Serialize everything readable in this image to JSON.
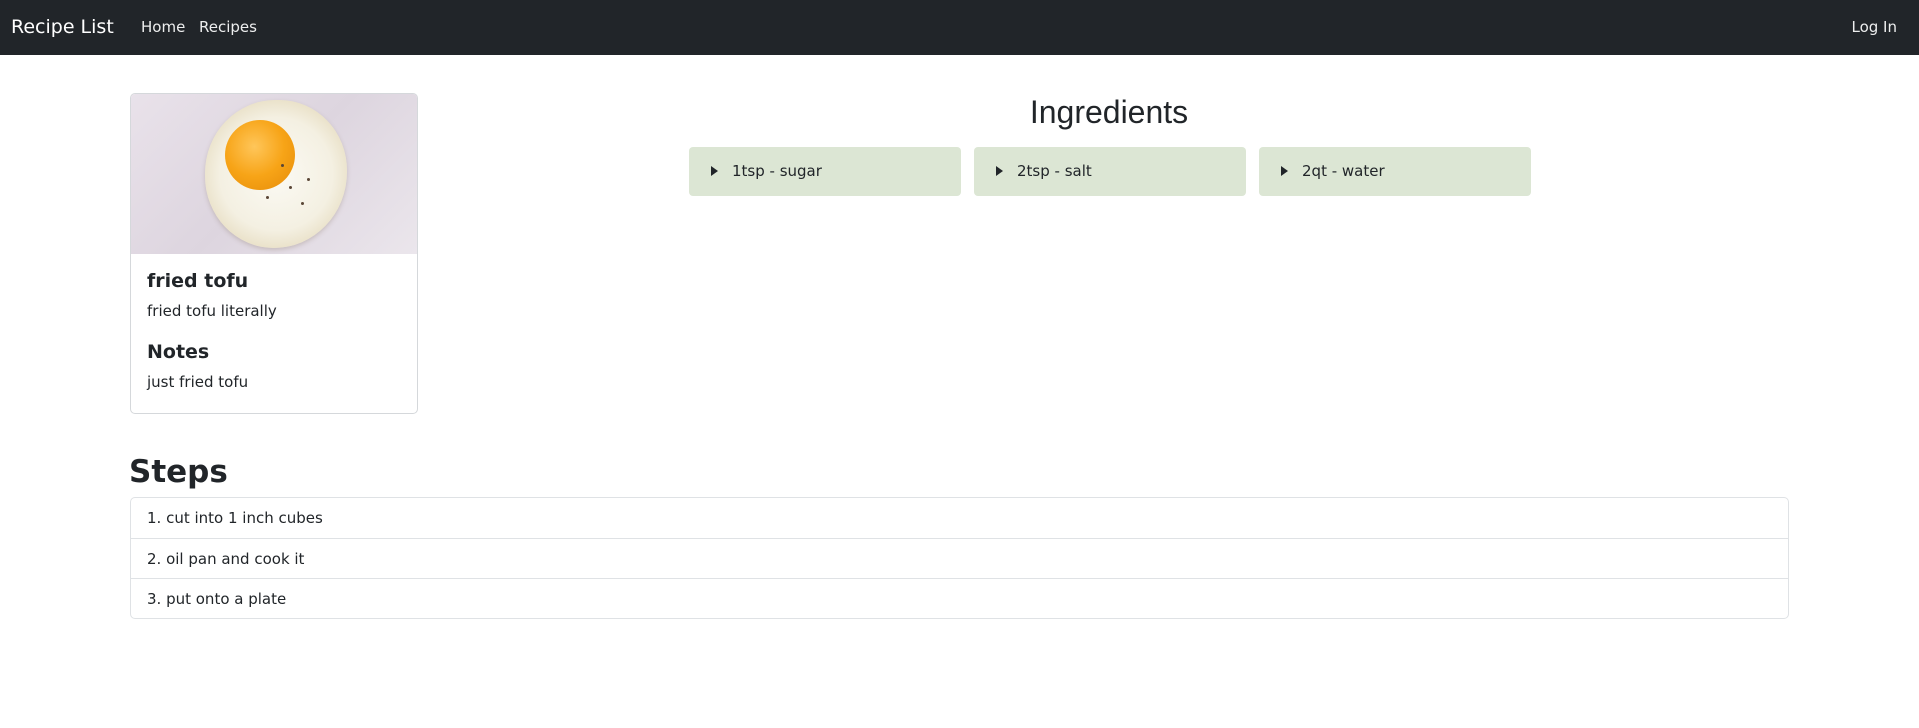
{
  "navbar": {
    "brand": "Recipe List",
    "links": [
      "Home",
      "Recipes"
    ],
    "login": "Log In"
  },
  "recipe": {
    "image_icon": "fried-egg-image",
    "title": "fried tofu",
    "description": "fried tofu literally",
    "notes_heading": "Notes",
    "notes": "just fried tofu"
  },
  "ingredients": {
    "heading": "Ingredients",
    "items": [
      {
        "label": "1tsp - sugar",
        "icon": "caret-right-icon"
      },
      {
        "label": "2tsp - salt",
        "icon": "caret-right-icon"
      },
      {
        "label": "2qt - water",
        "icon": "caret-right-icon"
      }
    ]
  },
  "steps": {
    "heading": "Steps",
    "items": [
      "1. cut into 1 inch cubes",
      "2. oil pan and cook it",
      "3. put onto a plate"
    ]
  },
  "colors": {
    "navbar": "#212529",
    "ingredient_bg": "#dce6d4",
    "border": "#dfe2e5"
  }
}
